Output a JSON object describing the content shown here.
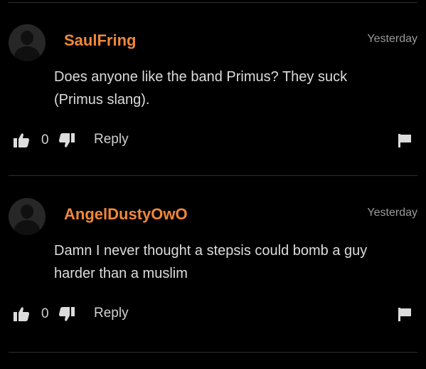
{
  "comments": [
    {
      "username": "SaulFring",
      "timestamp": "Yesterday",
      "text": "Does anyone like the band Primus? They suck (Primus slang).",
      "votes": "0",
      "reply_label": "Reply"
    },
    {
      "username": "AngelDustyOwO",
      "timestamp": "Yesterday",
      "text": "Damn I never thought a stepsis could bomb a guy harder than a muslim",
      "votes": "0",
      "reply_label": "Reply"
    }
  ],
  "colors": {
    "background": "#000000",
    "username": "#f0883a",
    "text": "#dcdcdc",
    "muted": "#9a9a9a",
    "divider": "#2c2c2c"
  },
  "icons": [
    "avatar-placeholder",
    "thumbs-up-icon",
    "thumbs-down-icon",
    "flag-icon"
  ]
}
